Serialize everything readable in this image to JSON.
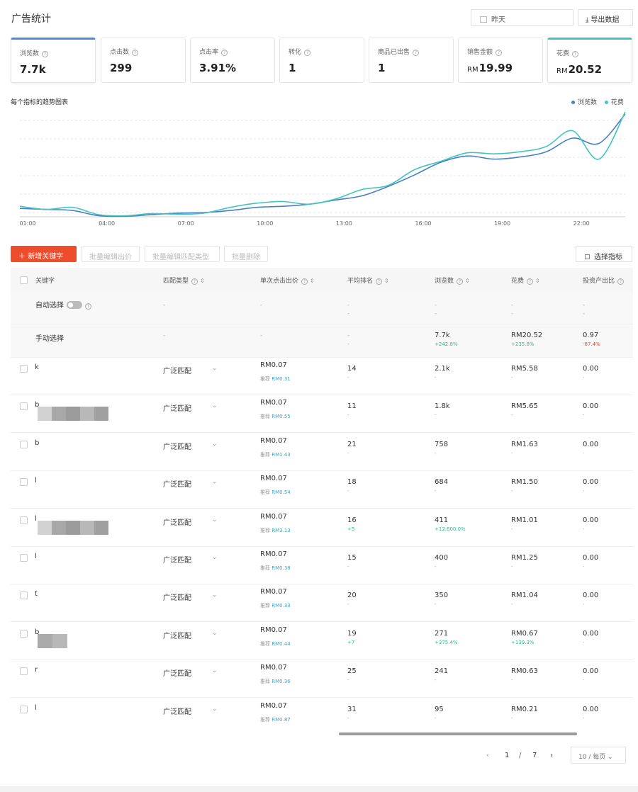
{
  "header": {
    "title": "广告统计",
    "date_value": "昨天",
    "export_label": "导出数据"
  },
  "kpis": [
    {
      "label": "浏览数",
      "value": "7.7k",
      "currency": ""
    },
    {
      "label": "点击数",
      "value": "299",
      "currency": ""
    },
    {
      "label": "点击率",
      "value": "3.91%",
      "currency": ""
    },
    {
      "label": "转化",
      "value": "1",
      "currency": ""
    },
    {
      "label": "商品已出售",
      "value": "1",
      "currency": ""
    },
    {
      "label": "销售金额",
      "value": "19.99",
      "currency": "RM"
    },
    {
      "label": "花费",
      "value": "20.52",
      "currency": "RM"
    }
  ],
  "chart": {
    "title": "每个指标的趋势图表",
    "x_ticks": [
      "01:00",
      "04:00",
      "07:00",
      "10:00",
      "13:00",
      "16:00",
      "19:00",
      "22:00"
    ],
    "legend": [
      {
        "name": "浏览数",
        "color": "#4a7fc1"
      },
      {
        "name": "花费",
        "color": "#43c4c0"
      }
    ]
  },
  "chart_data": {
    "type": "line",
    "title": "每个指标的趋势图表",
    "legend_position": "top-right",
    "grid": true,
    "x": [
      "01:00",
      "02:00",
      "03:00",
      "04:00",
      "05:00",
      "06:00",
      "07:00",
      "08:00",
      "09:00",
      "10:00",
      "11:00",
      "12:00",
      "13:00",
      "14:00",
      "15:00",
      "16:00",
      "17:00",
      "18:00",
      "19:00",
      "20:00",
      "21:00",
      "22:00",
      "23:00",
      "24:00"
    ],
    "series": [
      {
        "name": "浏览数",
        "values": [
          8,
          7,
          6,
          1,
          0.5,
          2,
          3.5,
          4,
          6,
          9,
          10,
          12,
          16,
          20,
          29,
          40,
          52,
          58,
          55,
          57,
          62,
          75,
          70,
          98
        ]
      },
      {
        "name": "花费",
        "values": [
          10,
          7,
          9,
          2,
          1,
          3,
          2.5,
          3.5,
          9,
          13,
          14.5,
          12,
          17,
          26,
          30,
          45,
          53,
          61,
          60,
          62,
          67,
          82,
          55,
          100
        ]
      }
    ]
  },
  "toolbar": {
    "add_keyword": "新增关键字",
    "batch_bid": "批量编辑出价",
    "batch_match": "批量编辑匹配类型",
    "batch_delete": "批量删除",
    "select_metrics": "选择指标"
  },
  "table": {
    "headers": {
      "keyword": "关键字",
      "match_type": "匹配类型",
      "bid": "单次点击出价",
      "rank": "平均排名",
      "impressions": "浏览数",
      "expense": "花费",
      "roas": "投资产出比"
    },
    "auto_row": {
      "label": "自动选择"
    },
    "manual_row": {
      "label": "手动选择",
      "impressions": "7.7k",
      "impressions_delta": "+242.8%",
      "expense": "RM20.52",
      "expense_delta": "+235.8%",
      "roas": "0.97",
      "roas_delta": "-87.4%"
    },
    "rows": [
      {
        "keyword": "k",
        "match": "广泛匹配",
        "bid": "RM0.07",
        "rec_prefix": "推荐",
        "rec": "RM0.31",
        "rank": "14",
        "rank_sub": "-",
        "imp": "2.1k",
        "imp_sub": "-",
        "exp": "RM5.58",
        "exp_sub": "-",
        "roas": "0.00",
        "roas_sub": "-",
        "blur": "none"
      },
      {
        "keyword": "b",
        "match": "广泛匹配",
        "bid": "RM0.07",
        "rec_prefix": "推荐",
        "rec": "RM0.55",
        "rank": "11",
        "rank_sub": "-",
        "imp": "1.8k",
        "imp_sub": "-",
        "exp": "RM5.65",
        "exp_sub": "-",
        "roas": "0.00",
        "roas_sub": "-",
        "blur": "long"
      },
      {
        "keyword": "b",
        "match": "广泛匹配",
        "bid": "RM0.07",
        "rec_prefix": "推荐",
        "rec": "RM1.43",
        "rank": "21",
        "rank_sub": "-",
        "imp": "758",
        "imp_sub": "-",
        "exp": "RM1.63",
        "exp_sub": "-",
        "roas": "0.00",
        "roas_sub": "-",
        "blur": "none"
      },
      {
        "keyword": "l",
        "match": "广泛匹配",
        "bid": "RM0.07",
        "rec_prefix": "推荐",
        "rec": "RM0.54",
        "rank": "18",
        "rank_sub": "-",
        "imp": "684",
        "imp_sub": "-",
        "exp": "RM1.50",
        "exp_sub": "-",
        "roas": "0.00",
        "roas_sub": "-",
        "blur": "none"
      },
      {
        "keyword": "l",
        "match": "广泛匹配",
        "bid": "RM0.07",
        "rec_prefix": "推荐",
        "rec": "RM3.13",
        "rank": "16",
        "rank_sub": "+5",
        "imp": "411",
        "imp_sub": "+12,600.0%",
        "exp": "RM1.01",
        "exp_sub": "-",
        "roas": "0.00",
        "roas_sub": "-",
        "blur": "long"
      },
      {
        "keyword": "l",
        "match": "广泛匹配",
        "bid": "RM0.07",
        "rec_prefix": "推荐",
        "rec": "RM0.38",
        "rank": "15",
        "rank_sub": "-",
        "imp": "400",
        "imp_sub": "-",
        "exp": "RM1.25",
        "exp_sub": "-",
        "roas": "0.00",
        "roas_sub": "-",
        "blur": "none"
      },
      {
        "keyword": "t",
        "match": "广泛匹配",
        "bid": "RM0.07",
        "rec_prefix": "推荐",
        "rec": "RM0.33",
        "rank": "20",
        "rank_sub": "-",
        "imp": "350",
        "imp_sub": "-",
        "exp": "RM1.04",
        "exp_sub": "-",
        "roas": "0.00",
        "roas_sub": "-",
        "blur": "none"
      },
      {
        "keyword": "b",
        "match": "广泛匹配",
        "bid": "RM0.07",
        "rec_prefix": "推荐",
        "rec": "RM0.44",
        "rank": "19",
        "rank_sub": "+7",
        "imp": "271",
        "imp_sub": "+375.4%",
        "exp": "RM0.67",
        "exp_sub": "+139.3%",
        "roas": "0.00",
        "roas_sub": "-",
        "blur": "short"
      },
      {
        "keyword": "r",
        "match": "广泛匹配",
        "bid": "RM0.07",
        "rec_prefix": "推荐",
        "rec": "RM0.36",
        "rank": "25",
        "rank_sub": "-",
        "imp": "241",
        "imp_sub": "-",
        "exp": "RM0.63",
        "exp_sub": "-",
        "roas": "0.00",
        "roas_sub": "-",
        "blur": "none"
      },
      {
        "keyword": "l",
        "match": "广泛匹配",
        "bid": "RM0.07",
        "rec_prefix": "推荐",
        "rec": "RM0.87",
        "rank": "31",
        "rank_sub": "-",
        "imp": "95",
        "imp_sub": "-",
        "exp": "RM0.21",
        "exp_sub": "-",
        "roas": "0.00",
        "roas_sub": "-",
        "blur": "none"
      }
    ]
  },
  "pagination": {
    "current": "1",
    "separator": "/",
    "total": "7",
    "page_size": "10 / 每页"
  }
}
